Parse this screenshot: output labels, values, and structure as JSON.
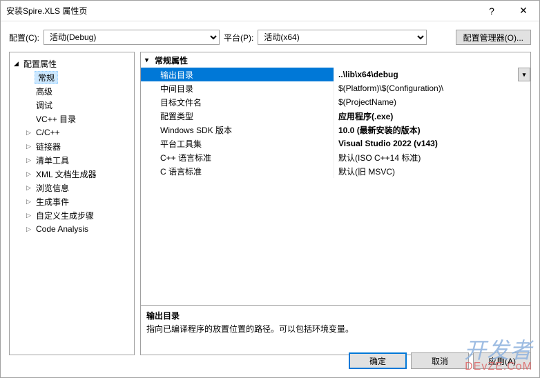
{
  "window": {
    "title": "安装Spire.XLS 属性页",
    "help": "?",
    "close": "✕"
  },
  "toolbar": {
    "config_label": "配置(C):",
    "config_value": "活动(Debug)",
    "platform_label": "平台(P):",
    "platform_value": "活动(x64)",
    "config_manager": "配置管理器(O)..."
  },
  "tree": {
    "root": "配置属性",
    "items": [
      {
        "label": "常规",
        "leaf": true,
        "selected": true
      },
      {
        "label": "高级",
        "leaf": true
      },
      {
        "label": "调试",
        "leaf": true
      },
      {
        "label": "VC++ 目录",
        "leaf": true
      },
      {
        "label": "C/C++",
        "leaf": false
      },
      {
        "label": "链接器",
        "leaf": false
      },
      {
        "label": "清单工具",
        "leaf": false
      },
      {
        "label": "XML 文档生成器",
        "leaf": false
      },
      {
        "label": "浏览信息",
        "leaf": false
      },
      {
        "label": "生成事件",
        "leaf": false
      },
      {
        "label": "自定义生成步骤",
        "leaf": false
      },
      {
        "label": "Code Analysis",
        "leaf": false
      }
    ]
  },
  "propgroup": {
    "header": "常规属性",
    "rows": [
      {
        "name": "输出目录",
        "value": "..\\lib\\x64\\debug",
        "bold": true,
        "selected": true
      },
      {
        "name": "中间目录",
        "value": "$(Platform)\\$(Configuration)\\",
        "bold": false
      },
      {
        "name": "目标文件名",
        "value": "$(ProjectName)",
        "bold": false
      },
      {
        "name": "配置类型",
        "value": "应用程序(.exe)",
        "bold": true
      },
      {
        "name": "Windows SDK 版本",
        "value": "10.0 (最新安装的版本)",
        "bold": true
      },
      {
        "name": "平台工具集",
        "value": "Visual Studio 2022 (v143)",
        "bold": true
      },
      {
        "name": "C++ 语言标准",
        "value": "默认(ISO C++14 标准)",
        "bold": false
      },
      {
        "name": "C 语言标准",
        "value": "默认(旧 MSVC)",
        "bold": false
      }
    ]
  },
  "description": {
    "title": "输出目录",
    "body": "指向已编译程序的放置位置的路径。可以包括环境变量。"
  },
  "buttons": {
    "ok": "确定",
    "cancel": "取消",
    "apply": "应用(A)"
  },
  "watermark": {
    "line1": "开发者",
    "line2": "DEvZE.CoM"
  }
}
